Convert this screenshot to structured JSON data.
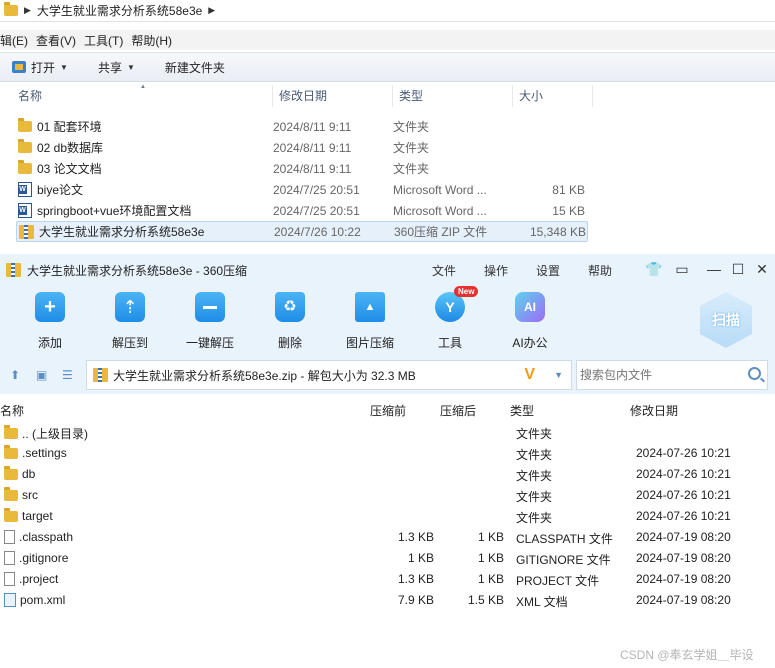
{
  "explorer": {
    "address_path": "大学生就业需求分析系统58e3e",
    "menu": [
      "辑(E)",
      "查看(V)",
      "工具(T)",
      "帮助(H)"
    ],
    "toolbar": {
      "open_label": "打开",
      "share_label": "共享",
      "new_folder_label": "新建文件夹"
    },
    "columns": {
      "name": "名称",
      "date": "修改日期",
      "type": "类型",
      "size": "大小"
    },
    "files": [
      {
        "icon": "folder-icon",
        "name": "01 配套环境",
        "date": "2024/8/11 9:11",
        "type": "文件夹",
        "size": ""
      },
      {
        "icon": "folder-icon",
        "name": "02 db数据库",
        "date": "2024/8/11 9:11",
        "type": "文件夹",
        "size": ""
      },
      {
        "icon": "folder-icon",
        "name": "03 论文文档",
        "date": "2024/8/11 9:11",
        "type": "文件夹",
        "size": ""
      },
      {
        "icon": "word-doc-icon",
        "name": "biye论文",
        "date": "2024/7/25 20:51",
        "type": "Microsoft Word ...",
        "size": "81 KB"
      },
      {
        "icon": "word-doc-icon",
        "name": "springboot+vue环境配置文档",
        "date": "2024/7/25 20:51",
        "type": "Microsoft Word ...",
        "size": "15 KB"
      },
      {
        "icon": "zip-archive-icon",
        "name": "大学生就业需求分析系统58e3e",
        "date": "2024/7/26 10:22",
        "type": "360压缩 ZIP 文件",
        "size": "15,348 KB"
      }
    ]
  },
  "zip": {
    "window_title": "大学生就业需求分析系统58e3e - 360压缩",
    "menu": [
      "文件",
      "操作",
      "设置",
      "帮助"
    ],
    "tools": [
      "添加",
      "解压到",
      "一键解压",
      "删除",
      "图片压缩",
      "工具",
      "AI办公"
    ],
    "new_badge": "New",
    "scan_label": "扫描",
    "path_text": "大学生就业需求分析系统58e3e.zip - 解包大小为 32.3 MB",
    "search_placeholder": "搜索包内文件",
    "columns": {
      "name": "名称",
      "compressed_before": "压缩前",
      "compressed_after": "压缩后",
      "type": "类型",
      "modified": "修改日期"
    },
    "entries": [
      {
        "icon": "folder-icon",
        "name": ".. (上级目录)",
        "before": "",
        "after": "",
        "type": "文件夹",
        "date": ""
      },
      {
        "icon": "folder-icon",
        "name": ".settings",
        "before": "",
        "after": "",
        "type": "文件夹",
        "date": "2024-07-26 10:21"
      },
      {
        "icon": "folder-icon",
        "name": "db",
        "before": "",
        "after": "",
        "type": "文件夹",
        "date": "2024-07-26 10:21"
      },
      {
        "icon": "folder-icon",
        "name": "src",
        "before": "",
        "after": "",
        "type": "文件夹",
        "date": "2024-07-26 10:21"
      },
      {
        "icon": "folder-icon",
        "name": "target",
        "before": "",
        "after": "",
        "type": "文件夹",
        "date": "2024-07-26 10:21"
      },
      {
        "icon": "file-icon",
        "name": ".classpath",
        "before": "1.3 KB",
        "after": "1 KB",
        "type": "CLASSPATH 文件",
        "date": "2024-07-19 08:20"
      },
      {
        "icon": "file-icon",
        "name": ".gitignore",
        "before": "1 KB",
        "after": "1 KB",
        "type": "GITIGNORE 文件",
        "date": "2024-07-19 08:20"
      },
      {
        "icon": "file-icon",
        "name": ".project",
        "before": "1.3 KB",
        "after": "1 KB",
        "type": "PROJECT 文件",
        "date": "2024-07-19 08:20"
      },
      {
        "icon": "xml-file-icon",
        "name": "pom.xml",
        "before": "7.9 KB",
        "after": "1.5 KB",
        "type": "XML 文档",
        "date": "2024-07-19 08:20"
      }
    ]
  },
  "watermark": "CSDN @奉玄学姐＿毕设"
}
